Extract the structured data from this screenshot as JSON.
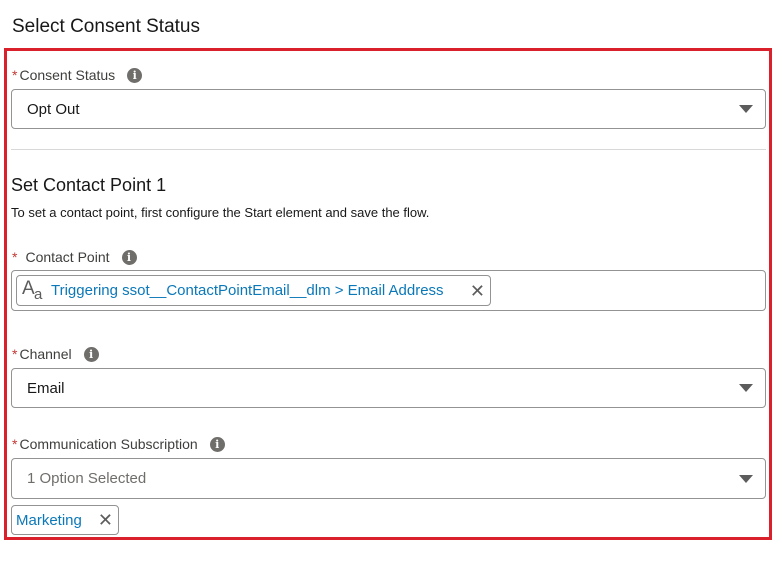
{
  "page": {
    "title": "Select Consent Status"
  },
  "consent_status": {
    "label": "Consent Status",
    "required": "*",
    "info_icon": "info-icon",
    "value": "Opt Out"
  },
  "contact_point_section": {
    "title": "Set Contact Point 1",
    "help_text": "To set a contact point, first configure the Start element and save the flow.",
    "contact_point": {
      "label": "Contact Point",
      "required": "*",
      "pill_text": "Triggering ssot__ContactPointEmail__dlm > Email Address",
      "type_icon": "text-type-icon"
    },
    "channel": {
      "label": "Channel",
      "required": "*",
      "value": "Email"
    },
    "communication_subscription": {
      "label": "Communication Subscription",
      "required": "*",
      "placeholder": "1 Option Selected",
      "selected": [
        "Marketing"
      ]
    }
  },
  "icons": {
    "info": "i",
    "remove": "✕",
    "text_type_big": "A",
    "text_type_small": "a"
  },
  "colors": {
    "highlight_border": "#d9202b",
    "required": "#c23934",
    "link": "#0b78b9"
  }
}
